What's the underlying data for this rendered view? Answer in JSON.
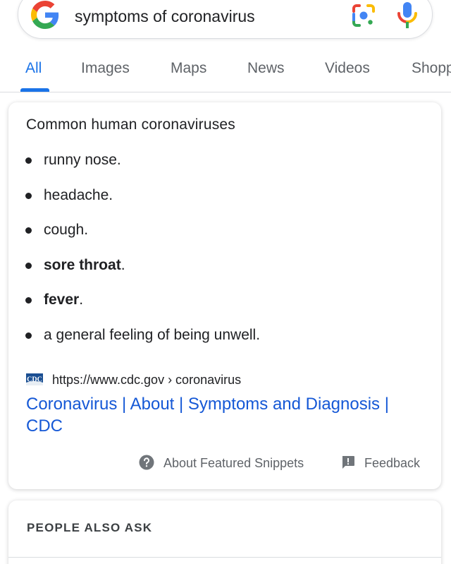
{
  "search": {
    "query": "symptoms of coronavirus"
  },
  "tabs": [
    {
      "label": "All",
      "active": true
    },
    {
      "label": "Images",
      "active": false
    },
    {
      "label": "Maps",
      "active": false
    },
    {
      "label": "News",
      "active": false
    },
    {
      "label": "Videos",
      "active": false
    },
    {
      "label": "Shopping",
      "active": false
    }
  ],
  "snippet": {
    "title": "Common human coronaviruses",
    "items": [
      {
        "text": "runny nose.",
        "bold": ""
      },
      {
        "text": "headache.",
        "bold": ""
      },
      {
        "text": "cough.",
        "bold": ""
      },
      {
        "bold": "sore throat",
        "text": "."
      },
      {
        "bold": "fever",
        "text": "."
      },
      {
        "text": "a general feeling of being unwell.",
        "bold": ""
      }
    ],
    "source_logo_text": "CDC",
    "source_url": "https://www.cdc.gov › coronavirus",
    "result_title": "Coronavirus | About | Symptoms and Diagnosis | CDC",
    "about_label": "About Featured Snippets",
    "feedback_label": "Feedback"
  },
  "people_also_ask": {
    "title": "PEOPLE ALSO ASK"
  },
  "colors": {
    "accent": "#1a73e8",
    "link": "#1558d6",
    "text": "#202124",
    "secondary_text": "#5f6368",
    "cdc_blue": "#1b4f92"
  },
  "icons": [
    "google-logo-icon",
    "google-lens-icon",
    "microphone-icon",
    "help-circle-icon",
    "feedback-icon",
    "cdc-logo-icon"
  ]
}
